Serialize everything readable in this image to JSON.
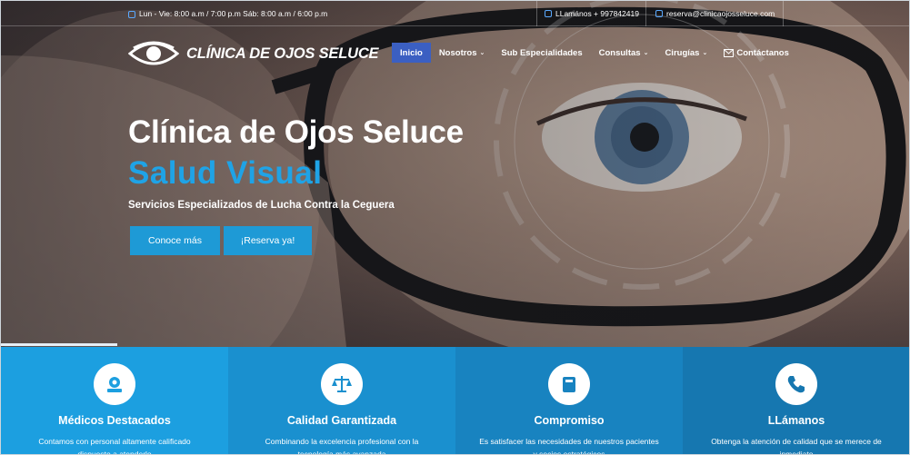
{
  "topbar": {
    "hours": "Lun - Vie: 8:00 a.m / 7:00 p.m Sáb: 8:00 a.m / 6:00 p.m",
    "phone": "LLamános + 997842419",
    "email": "reserva@clinicaojosseluce.com"
  },
  "logo": {
    "name": "CLÍNICA DE OJOS SELUCE"
  },
  "nav": [
    {
      "label": "Inicio",
      "active": true
    },
    {
      "label": "Nosotros",
      "dropdown": true
    },
    {
      "label": "Sub Especialidades"
    },
    {
      "label": "Consultas",
      "dropdown": true
    },
    {
      "label": "Cirugías",
      "dropdown": true
    },
    {
      "label": "Contáctanos",
      "icon": "envelope-icon"
    }
  ],
  "hero": {
    "title": "Clínica de Ojos Seluce",
    "title_highlight": "Salud Visual",
    "subtitle": "Servicios Especializados de Lucha Contra la Ceguera",
    "button_primary": "Conoce más",
    "button_secondary": "¡Reserva ya!"
  },
  "features": [
    {
      "icon": "doctor-icon",
      "title": "Médicos Destacados",
      "desc": "Contamos con personal altamente calificado dispuesto a atenderlo",
      "bg": "#1c9fe0"
    },
    {
      "icon": "scale-icon",
      "title": "Calidad Garantizada",
      "desc": "Combinando la excelencia profesional con la tecnología más avanzada",
      "bg": "#1a90cf"
    },
    {
      "icon": "clipboard-icon",
      "title": "Compromiso",
      "desc": "Es satisfacer las necesidades de nuestros pacientes y socios estratégicos",
      "bg": "#1883c0"
    },
    {
      "icon": "phone-icon",
      "title": "LLámanos",
      "desc": "Obtenga la atención de calidad que se merece de inmediato",
      "bg": "#1677b0"
    }
  ],
  "colors": {
    "accent": "#1e9ad6",
    "nav_active": "#3b5fc2",
    "highlight_text": "#1fa3e6"
  }
}
